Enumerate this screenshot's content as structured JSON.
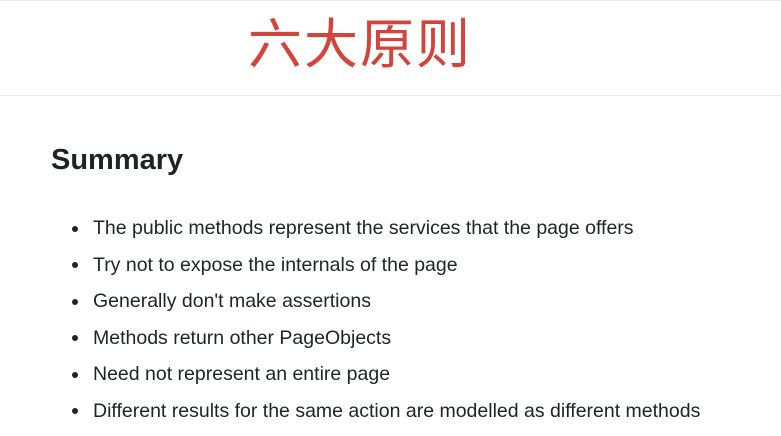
{
  "banner": {
    "title": "六大原则"
  },
  "summary": {
    "heading": "Summary",
    "items": [
      "The public methods represent the services that the page offers",
      "Try not to expose the internals of the page",
      "Generally don't make assertions",
      "Methods return other PageObjects",
      "Need not represent an entire page",
      "Different results for the same action are modelled as different methods"
    ]
  },
  "colors": {
    "banner_title": "#d3453c",
    "text": "#1f2328"
  }
}
